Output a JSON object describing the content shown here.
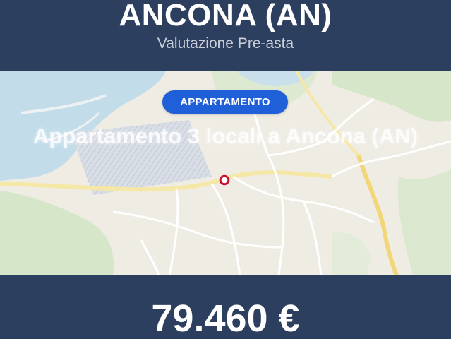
{
  "header": {
    "title": "ANCONA (AN)",
    "subtitle": "Valutazione Pre-asta"
  },
  "listing": {
    "type_badge": "APPARTAMENTO",
    "headline": "Appartamento 3 locali a Ancona (AN)"
  },
  "price": {
    "amount": "79.460 €"
  },
  "map": {
    "marker_icon": "location-marker-icon"
  },
  "colors": {
    "header_bg": "#2d3f5e",
    "footer_bg": "#2d3f5e",
    "badge_bg": "#1f5fd8",
    "marker": "#c41230",
    "sea": "#c2dcea",
    "land": "#efece4",
    "park": "#d6e6c8"
  }
}
